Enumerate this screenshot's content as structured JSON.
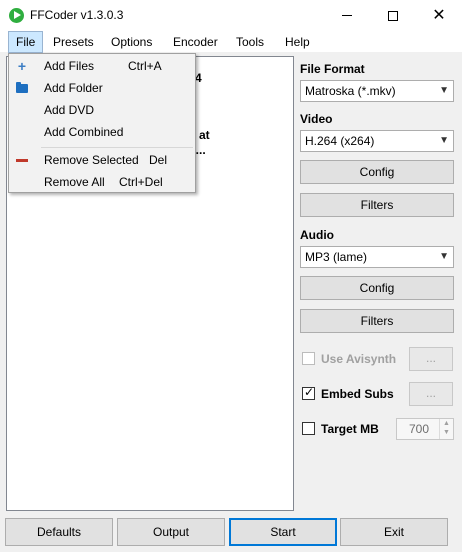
{
  "window": {
    "title": "FFCoder v1.3.0.3"
  },
  "menubar": {
    "items": [
      "File",
      "Presets",
      "Options",
      "Encoder",
      "Tools",
      "Help"
    ]
  },
  "file_menu": {
    "items": [
      {
        "label": "Add Files",
        "shortcut": "Ctrl+A",
        "icon": "plus-icon"
      },
      {
        "label": "Add Folder",
        "shortcut": "",
        "icon": "folder-icon"
      },
      {
        "label": "Add DVD",
        "shortcut": ""
      },
      {
        "label": "Add Combined",
        "shortcut": ""
      },
      {
        "label": "Remove Selected",
        "shortcut": "Del",
        "icon": "minus-icon"
      },
      {
        "label": "Remove All",
        "shortcut": "Ctrl+Del"
      }
    ]
  },
  "file_list": {
    "fragments": [
      "4",
      "s at",
      "8..."
    ]
  },
  "settings": {
    "file_format_label": "File Format",
    "file_format_value": "Matroska (*.mkv)",
    "video_label": "Video",
    "video_value": "H.264 (x264)",
    "video_config": "Config",
    "video_filters": "Filters",
    "audio_label": "Audio",
    "audio_value": "MP3 (lame)",
    "audio_config": "Config",
    "audio_filters": "Filters",
    "use_avisynth": {
      "label": "Use Avisynth",
      "checked": false,
      "enabled": false,
      "browse": "..."
    },
    "embed_subs": {
      "label": "Embed Subs",
      "checked": true,
      "browse": "..."
    },
    "target_mb": {
      "label": "Target MB",
      "checked": false,
      "value": "700"
    }
  },
  "bottom": {
    "defaults": "Defaults",
    "output": "Output",
    "start": "Start",
    "exit": "Exit"
  },
  "colors": {
    "menu_highlight": "#cce8ff",
    "default_button_border": "#0078d7",
    "icon_green": "#2fae3f"
  }
}
